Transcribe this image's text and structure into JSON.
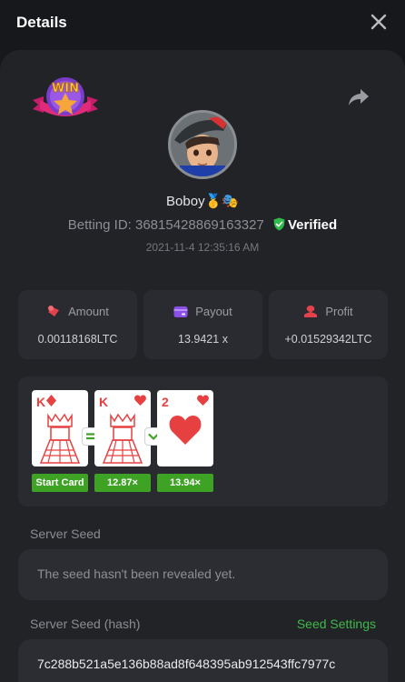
{
  "header": {
    "title": "Details"
  },
  "player": {
    "name": "Boboy",
    "emoji": "🥇🎭"
  },
  "bet": {
    "id_label": "Betting ID:",
    "id_value": "36815428869163327",
    "verified_label": "Verified",
    "timestamp": "2021-11-4 12:35:16 AM"
  },
  "stats": {
    "amount": {
      "label": "Amount",
      "value": "0.00118168LTC"
    },
    "payout": {
      "label": "Payout",
      "value": "13.9421 x"
    },
    "profit": {
      "label": "Profit",
      "value": "+0.01529342LTC"
    }
  },
  "cards": [
    {
      "rank": "K",
      "suit": "diamond",
      "caption": "Start Card"
    },
    {
      "rank": "K",
      "suit": "heart",
      "caption": "12.87×"
    },
    {
      "rank": "2",
      "suit": "heart",
      "caption": "13.94×"
    }
  ],
  "badges": {
    "win_text": "WIN"
  },
  "server_seed": {
    "label": "Server Seed",
    "text": "The seed hasn't been revealed yet."
  },
  "server_seed_hash": {
    "label": "Server Seed (hash)",
    "settings_link": "Seed Settings",
    "value": "7c288b521a5e136b88ad8f648395ab912543ffc7977c"
  },
  "colors": {
    "accent_green": "#3fb84a",
    "card_red": "#e64040",
    "panel": "#2a2b30",
    "sheet": "#222327",
    "background": "#17181b"
  },
  "icons": [
    "close-icon",
    "share-icon",
    "win-badge-icon",
    "amount-icon",
    "payout-icon",
    "profit-icon",
    "shield-check-icon",
    "equal-icon",
    "chevron-down-icon",
    "diamond-suit-icon",
    "heart-suit-icon"
  ]
}
